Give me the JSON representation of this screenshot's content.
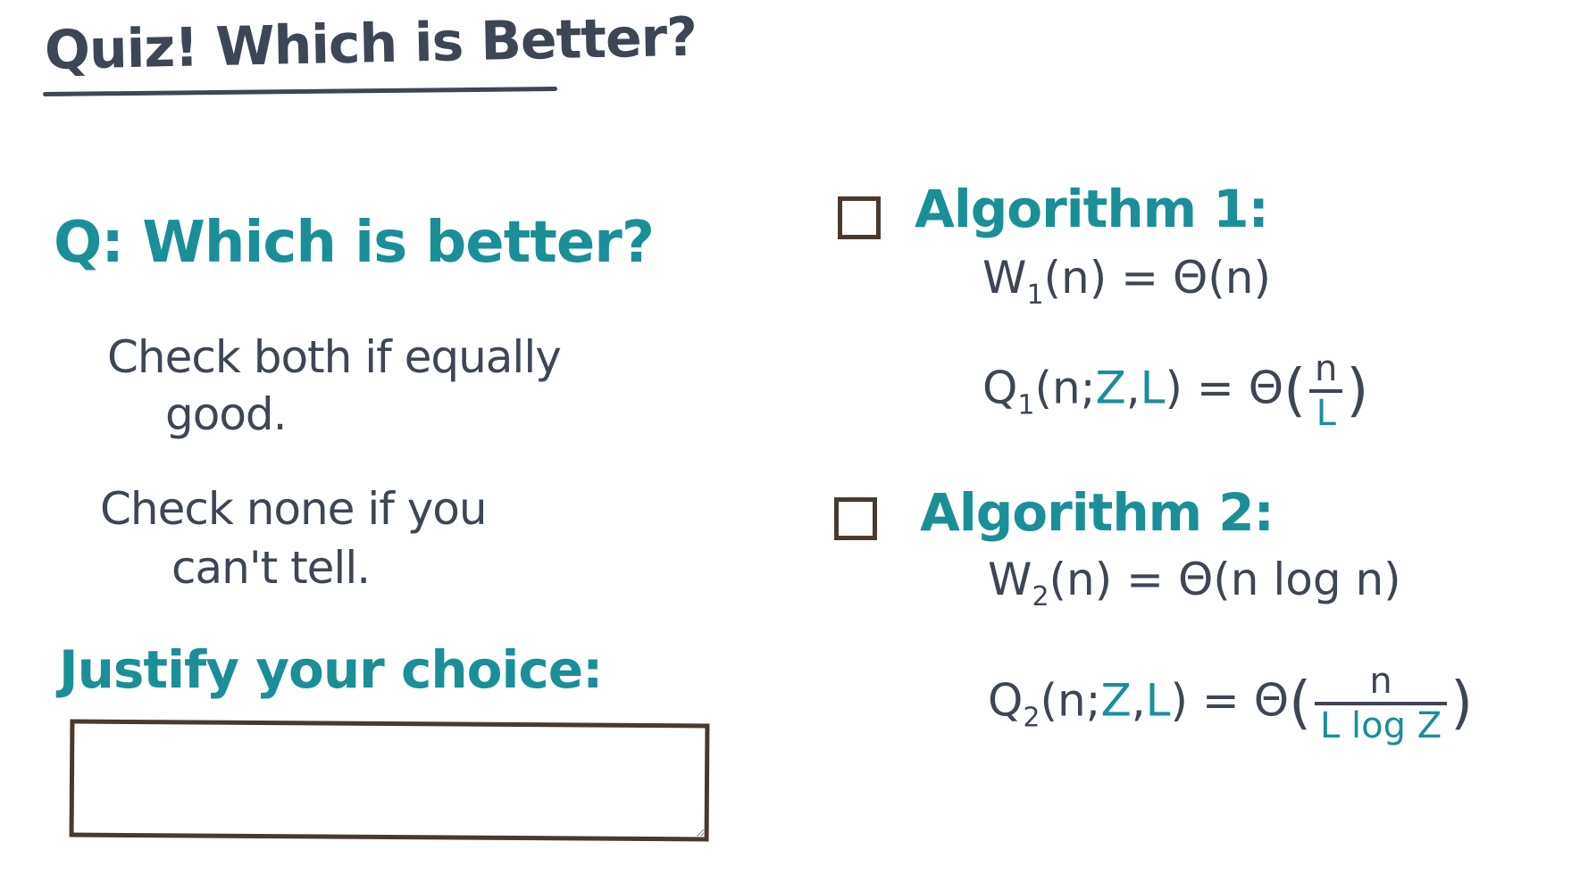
{
  "title": "Quiz! Which is Better?",
  "question": "Q: Which is better?",
  "hints": {
    "both_line1": "Check both if equally",
    "both_line2": "good.",
    "none_line1": "Check none if you",
    "none_line2": "can't tell."
  },
  "justify": {
    "label": "Justify your choice:",
    "value": ""
  },
  "algorithm1": {
    "label": "Algorithm 1:",
    "work_lhs": "W",
    "work_sub": "1",
    "work_arg": "(n) = ",
    "work_rhs": "Θ(n)",
    "q_lhs": "Q",
    "q_sub": "1",
    "q_open": "(n;",
    "q_z": "Z",
    "q_comma": ",",
    "q_l": "L",
    "q_close": ") = Θ",
    "q_num": "n",
    "q_den": "L"
  },
  "algorithm2": {
    "label": "Algorithm 2:",
    "work_lhs": "W",
    "work_sub": "2",
    "work_arg": "(n) = ",
    "work_rhs": "Θ(n log n)",
    "q_lhs": "Q",
    "q_sub": "2",
    "q_open": "(n;",
    "q_z": "Z",
    "q_comma": ",",
    "q_l": "L",
    "q_close": ") = Θ",
    "q_num": "n",
    "q_den": "L log Z"
  },
  "colors": {
    "teal": "#1a8f98",
    "ink": "#3d4654",
    "box_border": "#4a3a2e",
    "background": "#ffffff"
  }
}
